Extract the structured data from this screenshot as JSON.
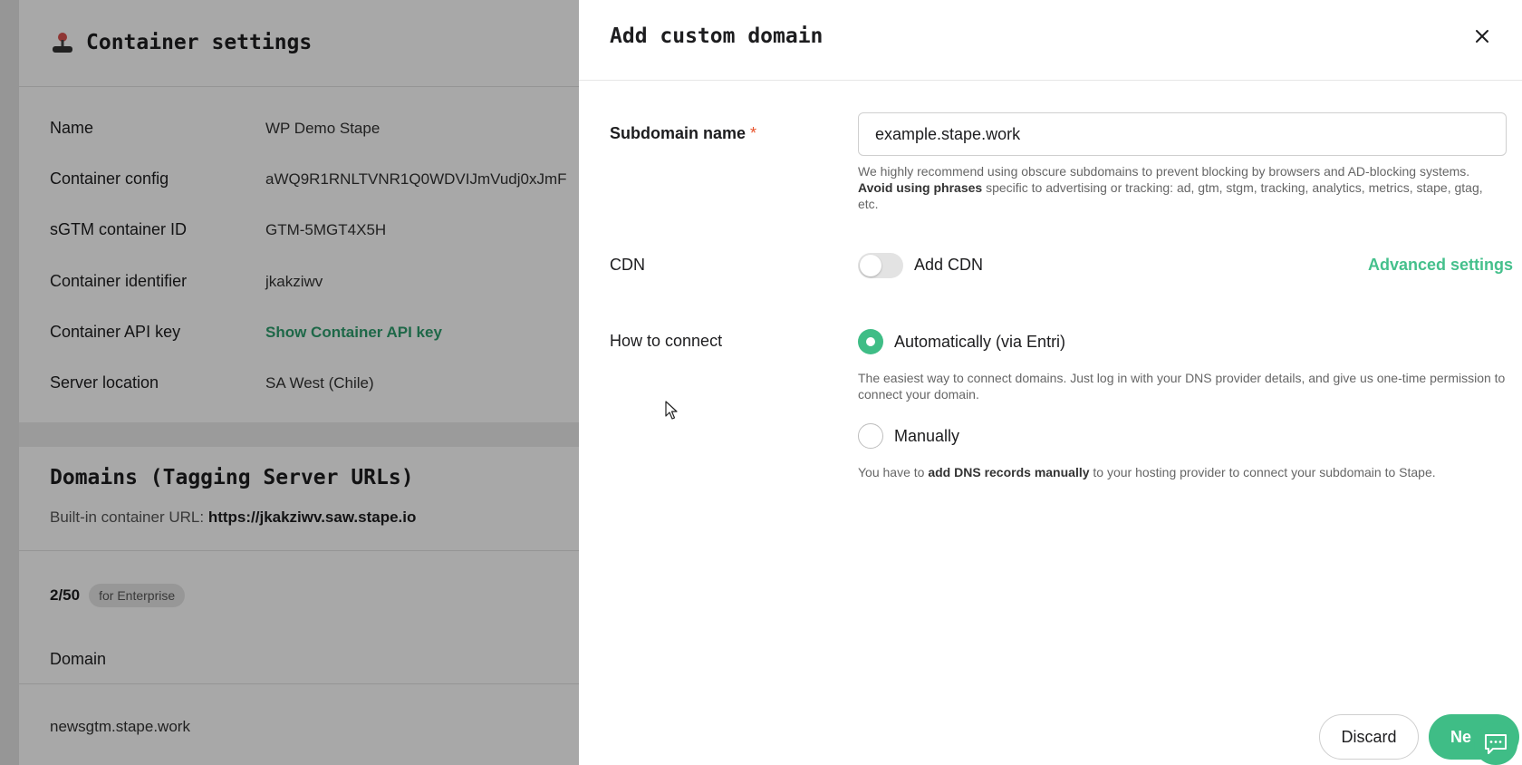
{
  "background": {
    "title": "Container settings",
    "rows": [
      {
        "label": "Name",
        "value": "WP Demo Stape"
      },
      {
        "label": "Container config",
        "value": "aWQ9R1RNLTVNR1Q0WDVIJmVudj0xJmF"
      },
      {
        "label": "sGTM container ID",
        "value": "GTM-5MGT4X5H"
      },
      {
        "label": "Container identifier",
        "value": "jkakziwv"
      },
      {
        "label": "Container API key",
        "value": "Show Container API key"
      },
      {
        "label": "Server location",
        "value": "SA West (Chile)"
      }
    ],
    "domains": {
      "title": "Domains (Tagging Server URLs)",
      "builtin_label": "Built-in container URL:",
      "builtin_url": "https://jkakziwv.saw.stape.io",
      "count": "2/50",
      "badge": "for Enterprise",
      "column_header": "Domain",
      "rows": [
        "newsgtm.stape.work"
      ]
    }
  },
  "panel": {
    "title": "Add custom domain",
    "subdomain": {
      "label": "Subdomain name",
      "required_mark": "*",
      "value": "example.stape.work",
      "hint_1": "We highly recommend using obscure subdomains to prevent blocking by browsers and AD-blocking systems.",
      "hint_bold": "Avoid using phrases",
      "hint_2": "specific to advertising or tracking: ad, gtm, stgm, tracking, analytics, metrics, stape, gtag, etc."
    },
    "cdn": {
      "label": "CDN",
      "toggle_label": "Add CDN",
      "advanced_link": "Advanced settings"
    },
    "connect": {
      "label": "How to connect",
      "option_auto": "Automatically (via Entri)",
      "auto_hint": "The easiest way to connect domains. Just log in with your DNS provider details, and give us one-time permission to connect your domain.",
      "option_manual": "Manually",
      "manual_hint_1": "You have to",
      "manual_hint_bold": "add DNS records manually",
      "manual_hint_2": "to your hosting provider to connect your subdomain to Stape."
    },
    "footer": {
      "discard": "Discard",
      "next": "Ne"
    }
  },
  "colors": {
    "accent": "#3fbd86",
    "link": "#2e9e6e",
    "required": "#e8542d"
  }
}
